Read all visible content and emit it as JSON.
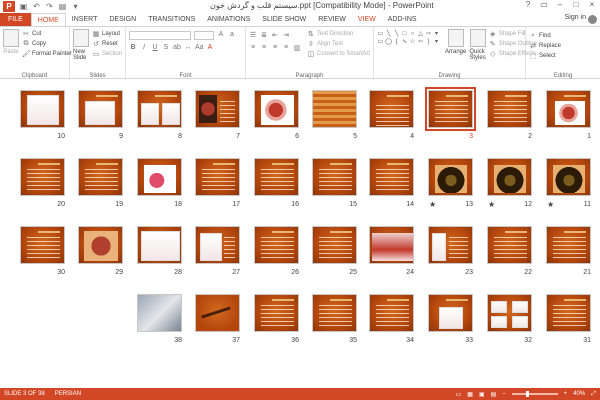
{
  "window": {
    "title": "سیستم قلب و گردش خون.ppt [Compatibility Mode] - PowerPoint",
    "app_icon": "P",
    "controls": [
      "?",
      "▭",
      "–",
      "□",
      "×"
    ]
  },
  "tabs": [
    {
      "label": "FILE"
    },
    {
      "label": "HOME"
    },
    {
      "label": "INSERT"
    },
    {
      "label": "DESIGN"
    },
    {
      "label": "TRANSITIONS"
    },
    {
      "label": "ANIMATIONS"
    },
    {
      "label": "SLIDE SHOW"
    },
    {
      "label": "REVIEW"
    },
    {
      "label": "VIEW"
    },
    {
      "label": "ADD-INS"
    }
  ],
  "signin": "Sign in",
  "ribbon": {
    "clipboard": {
      "paste": "Paste",
      "cut": "Cut",
      "copy": "Copy",
      "format_painter": "Format Painter",
      "label": "Clipboard"
    },
    "slides": {
      "new_slide": "New Slide",
      "layout": "Layout",
      "reset": "Reset",
      "section": "Section",
      "label": "Slides"
    },
    "font": {
      "label": "Font"
    },
    "paragraph": {
      "text_direction": "Text Direction",
      "align_text": "Align Text",
      "convert_smartart": "Convert to SmartArt",
      "label": "Paragraph"
    },
    "drawing": {
      "arrange": "Arrange",
      "quick_styles": "Quick Styles",
      "shape_fill": "Shape Fill",
      "shape_outline": "Shape Outline",
      "shape_effects": "Shape Effects",
      "label": "Drawing"
    },
    "editing": {
      "find": "Find",
      "replace": "Replace",
      "select": "Select",
      "label": "Editing"
    }
  },
  "slides": [
    {
      "num": "1"
    },
    {
      "num": "2"
    },
    {
      "num": "3"
    },
    {
      "num": "4"
    },
    {
      "num": "5"
    },
    {
      "num": "6"
    },
    {
      "num": "7"
    },
    {
      "num": "8"
    },
    {
      "num": "9"
    },
    {
      "num": "10"
    },
    {
      "num": "11"
    },
    {
      "num": "12"
    },
    {
      "num": "13"
    },
    {
      "num": "14"
    },
    {
      "num": "15"
    },
    {
      "num": "16"
    },
    {
      "num": "17"
    },
    {
      "num": "18"
    },
    {
      "num": "19"
    },
    {
      "num": "20"
    },
    {
      "num": "21"
    },
    {
      "num": "22"
    },
    {
      "num": "23"
    },
    {
      "num": "24"
    },
    {
      "num": "25"
    },
    {
      "num": "26"
    },
    {
      "num": "27"
    },
    {
      "num": "28"
    },
    {
      "num": "29"
    },
    {
      "num": "30"
    },
    {
      "num": "31"
    },
    {
      "num": "32"
    },
    {
      "num": "33"
    },
    {
      "num": "34"
    },
    {
      "num": "35"
    },
    {
      "num": "36"
    },
    {
      "num": "37"
    },
    {
      "num": "38"
    }
  ],
  "transition_marker": "★",
  "status": {
    "slide_info": "SLIDE 3 OF 38",
    "language": "PERSIAN",
    "zoom": "40%"
  },
  "colors": {
    "accent": "#d24726",
    "slide_bg": "#b9480c"
  }
}
